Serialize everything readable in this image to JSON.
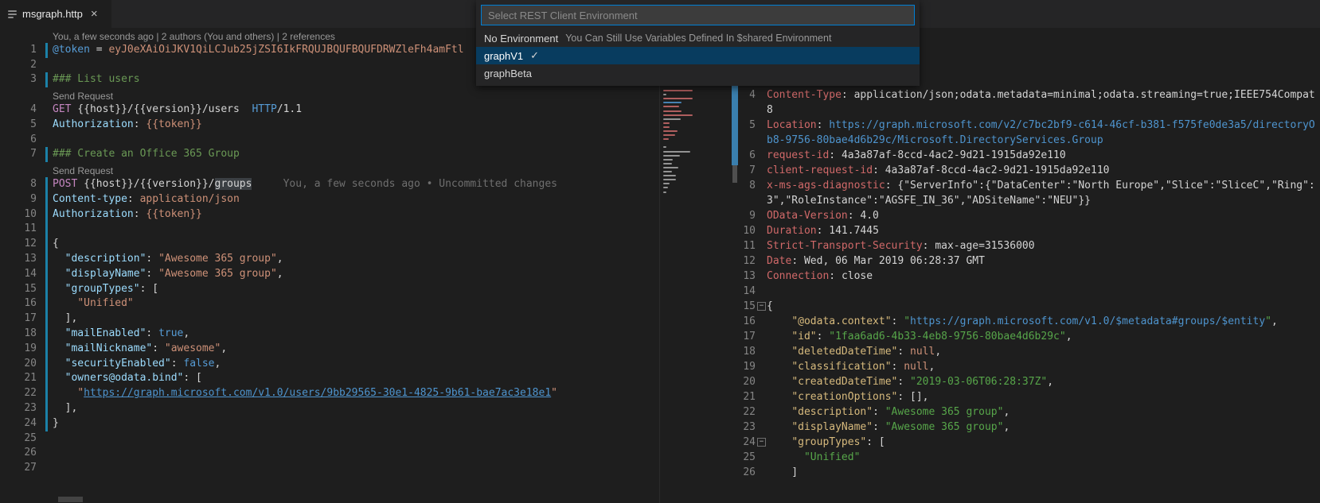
{
  "tab": {
    "title": "msgraph.http",
    "close_glyph": "×"
  },
  "icons": {
    "fold_collapse": "−",
    "check": "✓"
  },
  "colors": {
    "editor_bg": "#1e1e1e",
    "tabbar_bg": "#252526",
    "accent_border": "#007fd4",
    "selected_item_bg": "#083c5f",
    "modified_gutter": "#1b81a8",
    "method": "#c586c0",
    "comment": "#6a9955",
    "string": "#ce9178",
    "response_header": "#d16969",
    "response_key": "#d7ba7d",
    "response_string": "#57a64a",
    "link": "#4e94ce"
  },
  "environment_picker": {
    "placeholder": "Select REST Client Environment",
    "items": [
      {
        "label": "No Environment",
        "description": "You Can Still Use Variables Defined In $shared Environment",
        "selected": false,
        "checked": false
      },
      {
        "label": "graphV1",
        "description": "",
        "selected": true,
        "checked": true
      },
      {
        "label": "graphBeta",
        "description": "",
        "selected": false,
        "checked": false
      }
    ]
  },
  "left_editor": {
    "rows": [
      {
        "k": "lens",
        "t": "You, a few seconds ago | 2 authors (You and others) | 2 references"
      },
      {
        "k": "code",
        "n": "1",
        "ch": 1,
        "s": [
          [
            "@token",
            "kw"
          ],
          [
            " = ",
            "p"
          ],
          [
            "eyJ0eXAiOiJKV1QiLCJub25jZSI6IkFRQUJBQUFBQUFDRWZleFh4amFtl",
            "str"
          ]
        ]
      },
      {
        "k": "code",
        "n": "2"
      },
      {
        "k": "code",
        "n": "3",
        "ch": 1,
        "s": [
          [
            "### List users",
            "cmt"
          ]
        ]
      },
      {
        "k": "lens",
        "t": "Send Request"
      },
      {
        "k": "code",
        "n": "4",
        "s": [
          [
            "GET",
            "mth"
          ],
          [
            " {{host}}/{{version}}/users  ",
            "p"
          ],
          [
            "HTTP",
            "kw"
          ],
          [
            "/1.1",
            "p"
          ]
        ]
      },
      {
        "k": "code",
        "n": "5",
        "s": [
          [
            "Authorization",
            "hdr"
          ],
          [
            ": ",
            "p"
          ],
          [
            "{{token}}",
            "str"
          ]
        ]
      },
      {
        "k": "code",
        "n": "6"
      },
      {
        "k": "code",
        "n": "7",
        "ch": 1,
        "s": [
          [
            "### Create an Office 365 Group",
            "cmt"
          ]
        ]
      },
      {
        "k": "lens",
        "t": "Send Request"
      },
      {
        "k": "code",
        "n": "8",
        "ch": 1,
        "s": [
          [
            "POST",
            "mth"
          ],
          [
            " {{host}}/{{version}}/",
            "p"
          ],
          [
            "groups",
            "wh"
          ],
          [
            "     ",
            "p"
          ],
          [
            "You, a few seconds ago • Uncommitted changes",
            "dim"
          ]
        ]
      },
      {
        "k": "code",
        "n": "9",
        "ch": 1,
        "s": [
          [
            "Content-type",
            "hdr"
          ],
          [
            ": ",
            "p"
          ],
          [
            "application/json",
            "str"
          ]
        ]
      },
      {
        "k": "code",
        "n": "10",
        "ch": 1,
        "s": [
          [
            "Authorization",
            "hdr"
          ],
          [
            ": ",
            "p"
          ],
          [
            "{{token}}",
            "str"
          ]
        ]
      },
      {
        "k": "code",
        "n": "11",
        "ch": 1
      },
      {
        "k": "code",
        "n": "12",
        "ch": 1,
        "s": [
          [
            "{",
            "p"
          ]
        ]
      },
      {
        "k": "code",
        "n": "13",
        "ch": 1,
        "s": [
          [
            "  ",
            "p"
          ],
          [
            "\"description\"",
            "hdr"
          ],
          [
            ": ",
            "p"
          ],
          [
            "\"Awesome 365 group\"",
            "str"
          ],
          [
            ",",
            "p"
          ]
        ]
      },
      {
        "k": "code",
        "n": "14",
        "ch": 1,
        "s": [
          [
            "  ",
            "p"
          ],
          [
            "\"displayName\"",
            "hdr"
          ],
          [
            ": ",
            "p"
          ],
          [
            "\"Awesome 365 group\"",
            "str"
          ],
          [
            ",",
            "p"
          ]
        ]
      },
      {
        "k": "code",
        "n": "15",
        "ch": 1,
        "s": [
          [
            "  ",
            "p"
          ],
          [
            "\"groupTypes\"",
            "hdr"
          ],
          [
            ": [",
            "p"
          ]
        ]
      },
      {
        "k": "code",
        "n": "16",
        "ch": 1,
        "s": [
          [
            "    ",
            "p"
          ],
          [
            "\"Unified\"",
            "str"
          ]
        ]
      },
      {
        "k": "code",
        "n": "17",
        "ch": 1,
        "s": [
          [
            "  ],",
            "p"
          ]
        ]
      },
      {
        "k": "code",
        "n": "18",
        "ch": 1,
        "s": [
          [
            "  ",
            "p"
          ],
          [
            "\"mailEnabled\"",
            "hdr"
          ],
          [
            ": ",
            "p"
          ],
          [
            "true",
            "kw"
          ],
          [
            ",",
            "p"
          ]
        ]
      },
      {
        "k": "code",
        "n": "19",
        "ch": 1,
        "s": [
          [
            "  ",
            "p"
          ],
          [
            "\"mailNickname\"",
            "hdr"
          ],
          [
            ": ",
            "p"
          ],
          [
            "\"awesome\"",
            "str"
          ],
          [
            ",",
            "p"
          ]
        ]
      },
      {
        "k": "code",
        "n": "20",
        "ch": 1,
        "s": [
          [
            "  ",
            "p"
          ],
          [
            "\"securityEnabled\"",
            "hdr"
          ],
          [
            ": ",
            "p"
          ],
          [
            "false",
            "kw"
          ],
          [
            ",",
            "p"
          ]
        ]
      },
      {
        "k": "code",
        "n": "21",
        "ch": 1,
        "s": [
          [
            "  ",
            "p"
          ],
          [
            "\"owners@odata.bind\"",
            "hdr"
          ],
          [
            ": [",
            "p"
          ]
        ]
      },
      {
        "k": "code",
        "n": "22",
        "ch": 1,
        "s": [
          [
            "    ",
            "p"
          ],
          [
            "\"",
            "str"
          ],
          [
            "https://graph.microsoft.com/v1.0/users/9bb29565-30e1-4825-9b61-bae7ac3e18e1",
            "lnk"
          ],
          [
            "\"",
            "str"
          ]
        ]
      },
      {
        "k": "code",
        "n": "23",
        "ch": 1,
        "s": [
          [
            "  ],",
            "p"
          ]
        ]
      },
      {
        "k": "code",
        "n": "24",
        "ch": 1,
        "s": [
          [
            "}",
            "p"
          ]
        ]
      },
      {
        "k": "code",
        "n": "25"
      },
      {
        "k": "code",
        "n": "26"
      },
      {
        "k": "code",
        "n": "27"
      }
    ]
  },
  "right_editor": {
    "rows": [
      {
        "n": "4",
        "s": [
          [
            "Content-Type",
            "rk"
          ],
          [
            ": ",
            "p"
          ],
          [
            "application/json;odata.metadata=minimal;odata.streaming=true;IEEE754Compat",
            "p"
          ]
        ]
      },
      {
        "s": [
          [
            "8",
            "p"
          ]
        ]
      },
      {
        "n": "5",
        "s": [
          [
            "Location",
            "rk"
          ],
          [
            ": ",
            "p"
          ],
          [
            "https://graph.microsoft.com/v2/c7bc2bf9-c614-46cf-b381-f575fe0de3a5/directoryO",
            "url"
          ]
        ]
      },
      {
        "s": [
          [
            "b8-9756-80bae4d6b29c/Microsoft.DirectoryServices.Group",
            "url"
          ]
        ]
      },
      {
        "n": "6",
        "s": [
          [
            "request-id",
            "rk"
          ],
          [
            ": ",
            "p"
          ],
          [
            "4a3a87af-8ccd-4ac2-9d21-1915da92e110",
            "p"
          ]
        ]
      },
      {
        "n": "7",
        "s": [
          [
            "client-request-id",
            "rk"
          ],
          [
            ": ",
            "p"
          ],
          [
            "4a3a87af-8ccd-4ac2-9d21-1915da92e110",
            "p"
          ]
        ]
      },
      {
        "n": "8",
        "s": [
          [
            "x-ms-ags-diagnostic",
            "rk"
          ],
          [
            ": ",
            "p"
          ],
          [
            "{\"ServerInfo\":{\"DataCenter\":\"North Europe\",\"Slice\":\"SliceC\",\"Ring\":",
            "p"
          ]
        ]
      },
      {
        "s": [
          [
            "3\",\"RoleInstance\":\"AGSFE_IN_36\",\"ADSiteName\":\"NEU\"}}",
            "p"
          ]
        ]
      },
      {
        "n": "9",
        "s": [
          [
            "OData-Version",
            "rk"
          ],
          [
            ": ",
            "p"
          ],
          [
            "4.0",
            "p"
          ]
        ]
      },
      {
        "n": "10",
        "s": [
          [
            "Duration",
            "rk"
          ],
          [
            ": ",
            "p"
          ],
          [
            "141.7445",
            "p"
          ]
        ]
      },
      {
        "n": "11",
        "s": [
          [
            "Strict-Transport-Security",
            "rk"
          ],
          [
            ": ",
            "p"
          ],
          [
            "max-age=31536000",
            "p"
          ]
        ]
      },
      {
        "n": "12",
        "s": [
          [
            "Date",
            "rk"
          ],
          [
            ": ",
            "p"
          ],
          [
            "Wed, 06 Mar 2019 06:28:37 GMT",
            "p"
          ]
        ]
      },
      {
        "n": "13",
        "s": [
          [
            "Connection",
            "rk"
          ],
          [
            ": ",
            "p"
          ],
          [
            "close",
            "p"
          ]
        ]
      },
      {
        "n": "14"
      },
      {
        "n": "15",
        "fold": 1,
        "s": [
          [
            "{",
            "p"
          ]
        ]
      },
      {
        "n": "16",
        "s": [
          [
            "    ",
            "p"
          ],
          [
            "\"@odata.context\"",
            "jk"
          ],
          [
            ": ",
            "p"
          ],
          [
            "\"",
            "js"
          ],
          [
            "https://graph.microsoft.com/v1.0/$metadata#groups/$entity",
            "url"
          ],
          [
            "\"",
            "js"
          ],
          [
            ",",
            "p"
          ]
        ]
      },
      {
        "n": "17",
        "s": [
          [
            "    ",
            "p"
          ],
          [
            "\"id\"",
            "jk"
          ],
          [
            ": ",
            "p"
          ],
          [
            "\"1faa6ad6-4b33-4eb8-9756-80bae4d6b29c\"",
            "js"
          ],
          [
            ",",
            "p"
          ]
        ]
      },
      {
        "n": "18",
        "s": [
          [
            "    ",
            "p"
          ],
          [
            "\"deletedDateTime\"",
            "jk"
          ],
          [
            ": ",
            "p"
          ],
          [
            "null",
            "nul"
          ],
          [
            ",",
            "p"
          ]
        ]
      },
      {
        "n": "19",
        "s": [
          [
            "    ",
            "p"
          ],
          [
            "\"classification\"",
            "jk"
          ],
          [
            ": ",
            "p"
          ],
          [
            "null",
            "nul"
          ],
          [
            ",",
            "p"
          ]
        ]
      },
      {
        "n": "20",
        "s": [
          [
            "    ",
            "p"
          ],
          [
            "\"createdDateTime\"",
            "jk"
          ],
          [
            ": ",
            "p"
          ],
          [
            "\"2019-03-06T06:28:37Z\"",
            "js"
          ],
          [
            ",",
            "p"
          ]
        ]
      },
      {
        "n": "21",
        "s": [
          [
            "    ",
            "p"
          ],
          [
            "\"creationOptions\"",
            "jk"
          ],
          [
            ": ",
            "p"
          ],
          [
            "[],",
            "p"
          ]
        ]
      },
      {
        "n": "22",
        "s": [
          [
            "    ",
            "p"
          ],
          [
            "\"description\"",
            "jk"
          ],
          [
            ": ",
            "p"
          ],
          [
            "\"Awesome 365 group\"",
            "js"
          ],
          [
            ",",
            "p"
          ]
        ]
      },
      {
        "n": "23",
        "s": [
          [
            "    ",
            "p"
          ],
          [
            "\"displayName\"",
            "jk"
          ],
          [
            ": ",
            "p"
          ],
          [
            "\"Awesome 365 group\"",
            "js"
          ],
          [
            ",",
            "p"
          ]
        ]
      },
      {
        "n": "24",
        "fold": 1,
        "s": [
          [
            "    ",
            "p"
          ],
          [
            "\"groupTypes\"",
            "jk"
          ],
          [
            ": [",
            "p"
          ]
        ]
      },
      {
        "n": "25",
        "s": [
          [
            "      ",
            "p"
          ],
          [
            "\"Unified\"",
            "js"
          ]
        ]
      },
      {
        "n": "26",
        "s": [
          [
            "    ]",
            "p"
          ]
        ]
      }
    ]
  }
}
